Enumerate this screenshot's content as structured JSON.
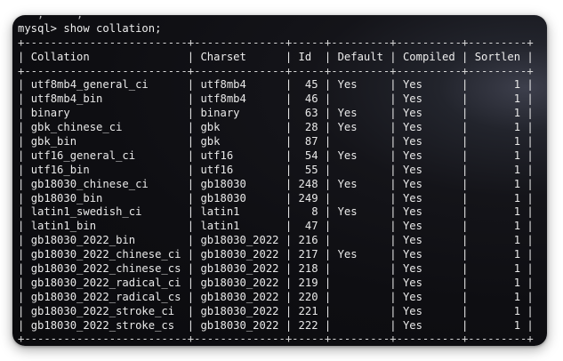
{
  "terminal": {
    "previous_output_fragment": "   ,     ,",
    "prompt": "mysql> ",
    "command": "show collation;",
    "columns": [
      "Collation",
      "Charset",
      "Id",
      "Default",
      "Compiled",
      "Sortlen"
    ],
    "rows": [
      [
        "utf8mb4_general_ci",
        "utf8mb4",
        "45",
        "Yes",
        "Yes",
        "1"
      ],
      [
        "utf8mb4_bin",
        "utf8mb4",
        "46",
        "",
        "Yes",
        "1"
      ],
      [
        "binary",
        "binary",
        "63",
        "Yes",
        "Yes",
        "1"
      ],
      [
        "gbk_chinese_ci",
        "gbk",
        "28",
        "Yes",
        "Yes",
        "1"
      ],
      [
        "gbk_bin",
        "gbk",
        "87",
        "",
        "Yes",
        "1"
      ],
      [
        "utf16_general_ci",
        "utf16",
        "54",
        "Yes",
        "Yes",
        "1"
      ],
      [
        "utf16_bin",
        "utf16",
        "55",
        "",
        "Yes",
        "1"
      ],
      [
        "gb18030_chinese_ci",
        "gb18030",
        "248",
        "Yes",
        "Yes",
        "1"
      ],
      [
        "gb18030_bin",
        "gb18030",
        "249",
        "",
        "Yes",
        "1"
      ],
      [
        "latin1_swedish_ci",
        "latin1",
        "8",
        "Yes",
        "Yes",
        "1"
      ],
      [
        "latin1_bin",
        "latin1",
        "47",
        "",
        "Yes",
        "1"
      ],
      [
        "gb18030_2022_bin",
        "gb18030_2022",
        "216",
        "",
        "Yes",
        "1"
      ],
      [
        "gb18030_2022_chinese_ci",
        "gb18030_2022",
        "217",
        "Yes",
        "Yes",
        "1"
      ],
      [
        "gb18030_2022_chinese_cs",
        "gb18030_2022",
        "218",
        "",
        "Yes",
        "1"
      ],
      [
        "gb18030_2022_radical_ci",
        "gb18030_2022",
        "219",
        "",
        "Yes",
        "1"
      ],
      [
        "gb18030_2022_radical_cs",
        "gb18030_2022",
        "220",
        "",
        "Yes",
        "1"
      ],
      [
        "gb18030_2022_stroke_ci",
        "gb18030_2022",
        "221",
        "",
        "Yes",
        "1"
      ],
      [
        "gb18030_2022_stroke_cs",
        "gb18030_2022",
        "222",
        "",
        "Yes",
        "1"
      ]
    ]
  },
  "colors": {
    "background": "#0e0e12",
    "text": "#e6e6e6"
  }
}
